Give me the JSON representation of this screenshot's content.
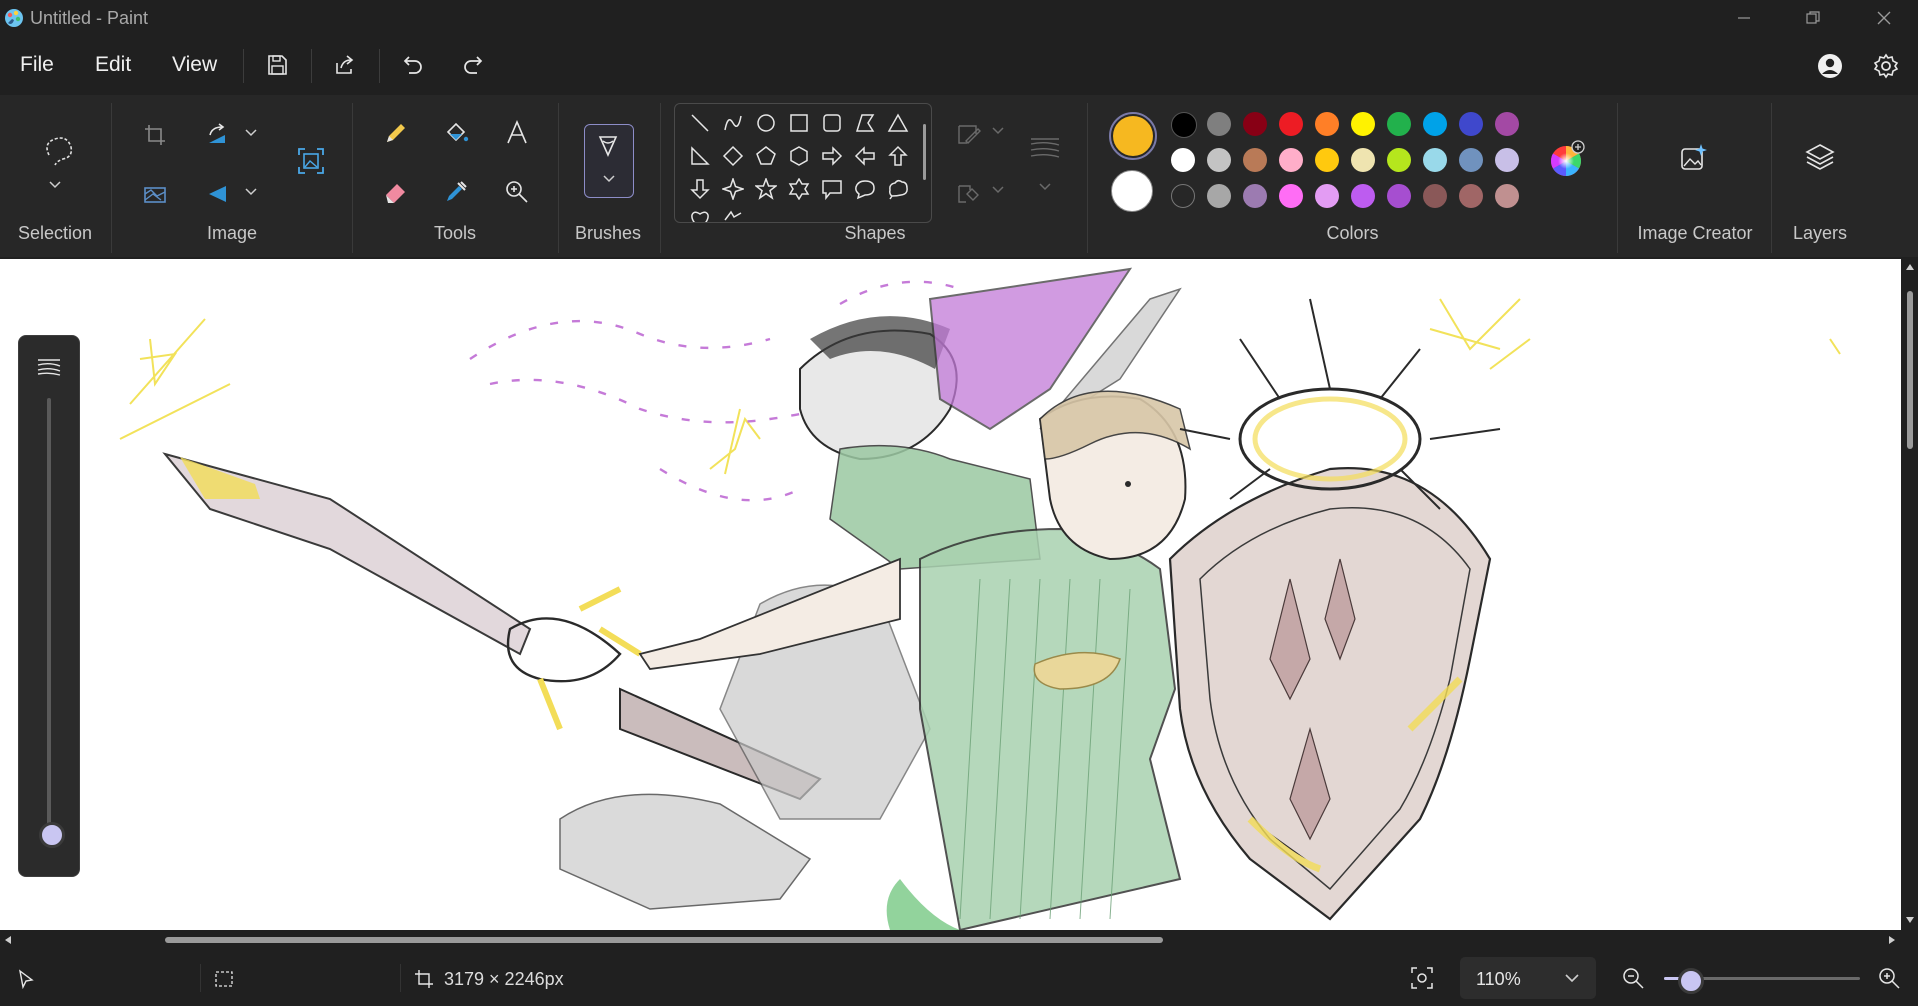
{
  "window": {
    "title": "Untitled - Paint"
  },
  "menu": {
    "file": "File",
    "edit": "Edit",
    "view": "View"
  },
  "ribbon": {
    "groups": {
      "selection": "Selection",
      "image": "Image",
      "tools": "Tools",
      "brushes": "Brushes",
      "shapes": "Shapes",
      "colors": "Colors",
      "image_creator": "Image Creator",
      "layers": "Layers"
    },
    "tool_icons": [
      "pencil-icon",
      "fill-bucket-icon",
      "text-icon",
      "eraser-icon",
      "color-picker-icon",
      "magnifier-icon"
    ],
    "shape_icons": [
      "line",
      "curve",
      "oval",
      "rectangle",
      "rounded-rectangle",
      "polygon",
      "triangle",
      "right-triangle",
      "diamond",
      "pentagon",
      "hexagon",
      "right-arrow",
      "left-arrow",
      "up-arrow",
      "down-arrow",
      "four-point-star",
      "five-point-star",
      "six-point-star",
      "rectangular-callout",
      "oval-callout",
      "cloud-callout"
    ]
  },
  "colors": {
    "primary": "#f6b820",
    "secondary": "#ffffff",
    "palette": [
      [
        "#000000",
        "#7f7f7f",
        "#880015",
        "#ed1c24",
        "#ff7f27",
        "#fff200",
        "#22b14c",
        "#00a2e8",
        "#3f48cc",
        "#a349a4"
      ],
      [
        "#ffffff",
        "#c3c3c3",
        "#b97a57",
        "#ffaec9",
        "#ffc90e",
        "#efe4b0",
        "#b5e61d",
        "#99d9ea",
        "#7092be",
        "#c8bfe7"
      ],
      [
        "empty",
        "#a7a7a7",
        "#9c7bb1",
        "#ff6df5",
        "#e39cf3",
        "#bd5cf0",
        "#a64ed0",
        "#8a5858",
        "#a06666",
        "#c09090"
      ]
    ]
  },
  "status": {
    "canvas_size": "3179 × 2246px",
    "zoom": "110%"
  }
}
